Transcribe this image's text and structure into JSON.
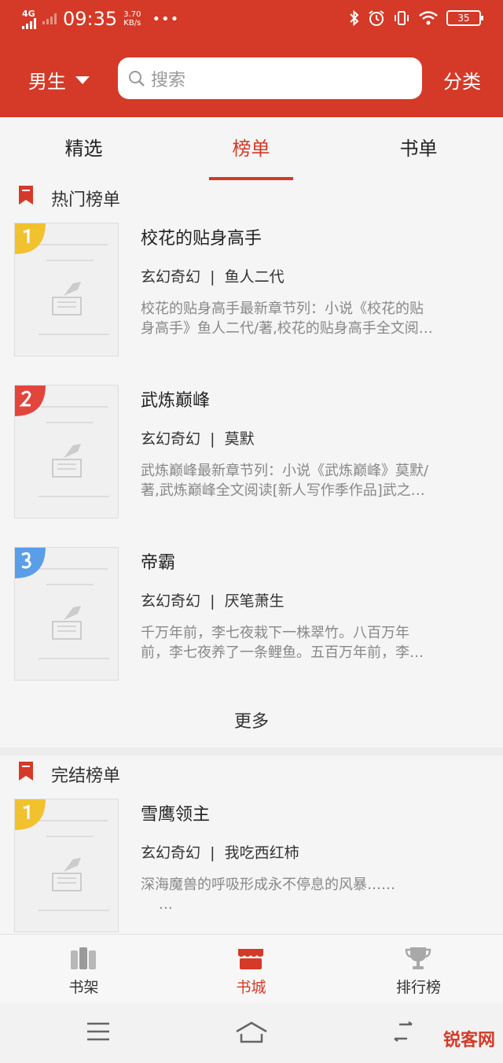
{
  "status_bar": {
    "network": "4G",
    "time": "09:35",
    "speed_value": "3.70",
    "speed_unit": "KB/s",
    "battery": "35"
  },
  "header": {
    "gender": "男生",
    "search_placeholder": "搜索",
    "category": "分类"
  },
  "tabs": [
    {
      "label": "精选",
      "active": false
    },
    {
      "label": "榜单",
      "active": true
    },
    {
      "label": "书单",
      "active": false
    }
  ],
  "sections": [
    {
      "title": "热门榜单",
      "books": [
        {
          "rank": "1",
          "title": "校花的贴身高手",
          "genre": "玄幻奇幻",
          "author": "鱼人二代",
          "desc": [
            "校花的贴身高手最新章节列：小说《校花的贴",
            "身高手》鱼人二代/著,校花的贴身高手全文阅…"
          ]
        },
        {
          "rank": "2",
          "title": "武炼巅峰",
          "genre": "玄幻奇幻",
          "author": "莫默",
          "desc": [
            "武炼巅峰最新章节列：小说《武炼巅峰》莫默/",
            "著,武炼巅峰全文阅读[新人写作季作品]武之…"
          ]
        },
        {
          "rank": "3",
          "title": "帝霸",
          "genre": "玄幻奇幻",
          "author": "厌笔萧生",
          "desc": [
            "千万年前，李七夜栽下一株翠竹。八百万年",
            "前，李七夜养了一条鲤鱼。五百万年前，李…"
          ]
        }
      ],
      "more": "更多"
    },
    {
      "title": "完结榜单",
      "books": [
        {
          "rank": "1",
          "title": "雪鹰领主",
          "genre": "玄幻奇幻",
          "author": "我吃西红柿",
          "desc": [
            "深海魔兽的呼吸形成永不停息的风暴……",
            "    …"
          ]
        }
      ]
    }
  ],
  "bottom_nav": [
    {
      "label": "书架",
      "icon": "bookshelf-icon",
      "active": false
    },
    {
      "label": "书城",
      "icon": "bookstore-icon",
      "active": true
    },
    {
      "label": "排行榜",
      "icon": "trophy-icon",
      "active": false
    }
  ],
  "watermark": "锐客网",
  "colors": {
    "brand": "#d43a27",
    "rank1": "#f2c12e",
    "rank2": "#e2453c",
    "rank3": "#5a9ee8"
  }
}
